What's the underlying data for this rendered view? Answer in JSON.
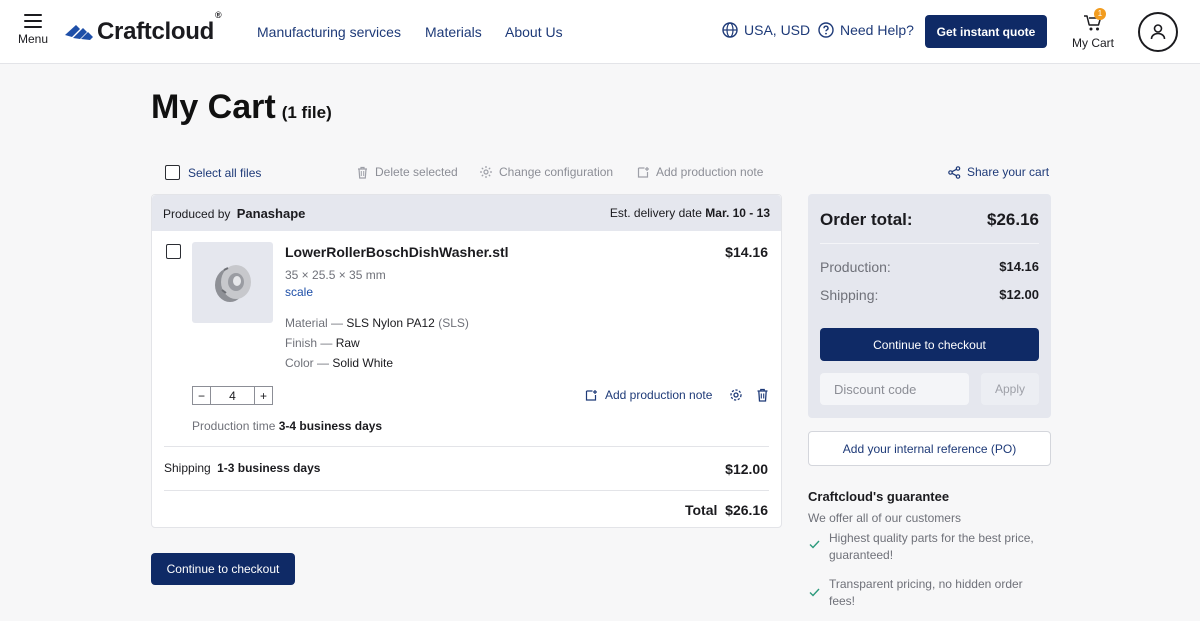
{
  "header": {
    "menu_label": "Menu",
    "logo_text": "Craftcloud",
    "logo_mark": "®",
    "nav": [
      "Manufacturing services",
      "Materials",
      "About Us"
    ],
    "region": "USA, USD",
    "help": "Need Help?",
    "quote_button": "Get instant quote",
    "cart_count": "1",
    "cart_label": "My Cart",
    "brand_color": "#0f2a66"
  },
  "page": {
    "title": "My Cart",
    "file_count": "(1 file)"
  },
  "toolbar": {
    "select_all": "Select all files",
    "delete_selected": "Delete selected",
    "change_configuration": "Change configuration",
    "add_production_note": "Add production note",
    "share_cart": "Share your cart"
  },
  "vendor": {
    "produced_by_label": "Produced by",
    "name": "Panashape",
    "delivery_label": "Est. delivery date",
    "delivery_dates": "Mar. 10 - 13"
  },
  "item": {
    "filename": "LowerRollerBoschDishWasher.stl",
    "price": "$14.16",
    "dimensions": "35 × 25.5 × 35 mm",
    "scale_link": "scale",
    "material_label": "Material — ",
    "material_value": "SLS Nylon PA12",
    "material_tech": "(SLS)",
    "finish_label": "Finish — ",
    "finish_value": "Raw",
    "color_label": "Color — ",
    "color_value": "Solid White",
    "quantity": "4",
    "minus": "−",
    "plus": "+",
    "add_note": "Add production note",
    "production_time_label": "Production time",
    "production_time_value": "3-4 business days"
  },
  "shipping": {
    "label": "Shipping",
    "time": "1-3 business days",
    "price": "$12.00"
  },
  "total": {
    "label": "Total",
    "value": "$26.16"
  },
  "checkout_button": "Continue to checkout",
  "order": {
    "title": "Order total:",
    "total": "$26.16",
    "production_label": "Production:",
    "production_value": "$14.16",
    "shipping_label": "Shipping:",
    "shipping_value": "$12.00",
    "checkout_button": "Continue to checkout",
    "discount_placeholder": "Discount code",
    "apply_button": "Apply",
    "po_button": "Add your internal reference (PO)"
  },
  "guarantee": {
    "title": "Craftcloud's guarantee",
    "subtitle": "We offer all of our customers",
    "items": [
      "Highest quality parts for the best price, guaranteed!",
      "Transparent pricing, no hidden order fees!"
    ]
  }
}
